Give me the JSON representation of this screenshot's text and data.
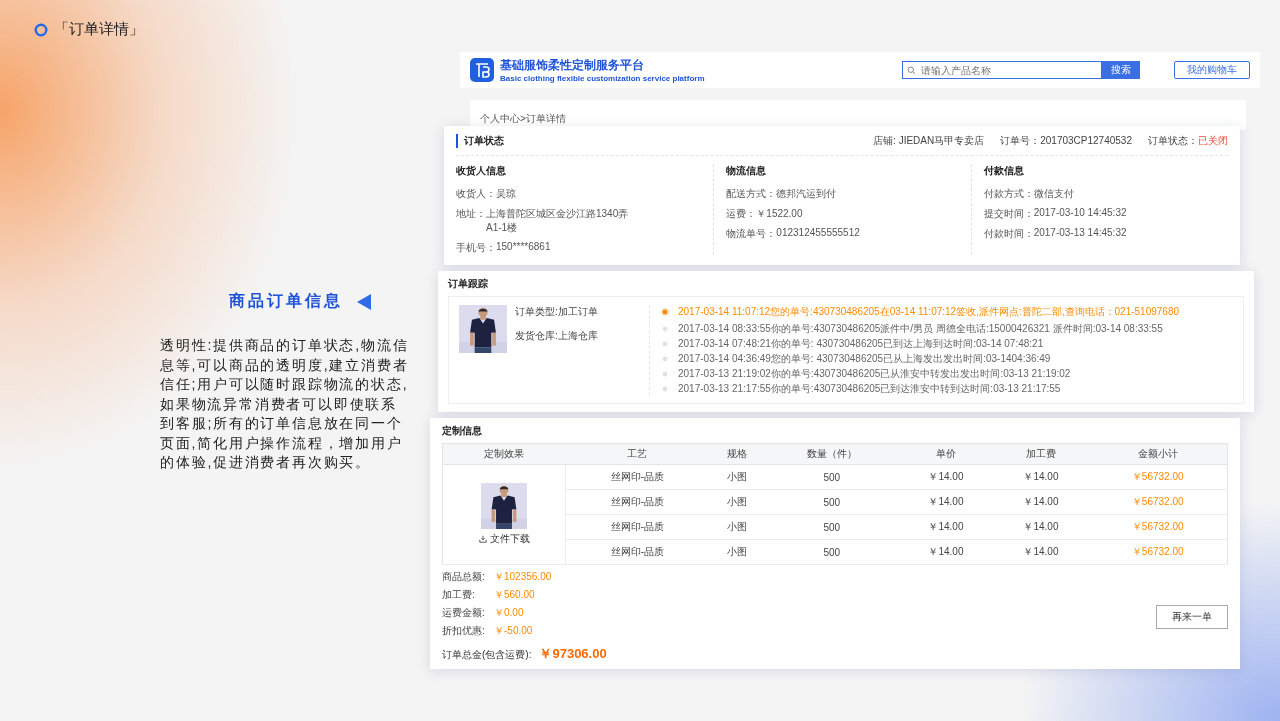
{
  "slide": {
    "title": "「订单详情」",
    "heading": "商品订单信息",
    "description": "透明性:提供商品的订单状态,物流信息等,可以商品的透明度,建立消费者信任;用户可以随时跟踪物流的状态,如果物流异常消费者可以即使联系到客服;所有的订单信息放在同一个页面,简化用户操作流程，增加用户的体验,促进消费者再次购买。"
  },
  "header": {
    "logo_title": "基础服饰柔性定制服务平台",
    "logo_subtitle": "Basic clothing flexible customization service platform",
    "search": {
      "placeholder": "请输入产品名称",
      "button": "搜索"
    },
    "cart_button": "我的购物车"
  },
  "breadcrumb": "个人中心>订单详情",
  "order_status": {
    "title": "订单状态",
    "shop": "店铺: JIEDAN马甲专卖店",
    "order_no": "订单号：201703CP12740532",
    "status_label": "订单状态：",
    "status": "已关闭",
    "sections": [
      {
        "title": "收货人信息",
        "lines": [
          {
            "label": "收货人：",
            "value": [
              "吴琼"
            ]
          },
          {
            "label": "地址：",
            "value": [
              "上海普陀区城区金沙江路1340弄",
              "A1-1楼"
            ]
          },
          {
            "label": "手机号：",
            "value": [
              "150****6861"
            ]
          }
        ]
      },
      {
        "title": "物流信息",
        "lines": [
          {
            "label": "配送方式：",
            "value": [
              "德邦汽运到付"
            ]
          },
          {
            "label": "运费：",
            "value": [
              "￥1522.00"
            ]
          },
          {
            "label": "物流单号：",
            "value": [
              "012312455555512"
            ]
          }
        ]
      },
      {
        "title": "付款信息",
        "lines": [
          {
            "label": "付款方式：",
            "value": [
              "微信支付"
            ]
          },
          {
            "label": "提交时间：",
            "value": [
              "2017-03-10 14:45:32"
            ]
          },
          {
            "label": "付款时间：",
            "value": [
              "2017-03-13 14:45:32"
            ]
          }
        ]
      }
    ]
  },
  "tracking": {
    "title": "订单跟踪",
    "order_type": "订单类型:加工订单",
    "warehouse": "发货仓库:上海仓库",
    "events": [
      {
        "text": "2017-03-14 11:07:12您的单号:430730486205在03-14 11:07:12签收,派件网点:普陀二部,查询电话：021-51097680",
        "current": true
      },
      {
        "text": "2017-03-14 08:33:55你的单号:430730486205派件中/男员 周德全电话:15000426321 派件时间:03-14 08:33:55",
        "current": false
      },
      {
        "text": "2017-03-14 07:48:21你的单号: 430730486205已到达上海到达时间:03-14 07:48:21",
        "current": false
      },
      {
        "text": "2017-03-14 04:36:49您的单号: 430730486205已从上海发出发出时间:03-1404:36:49",
        "current": false
      },
      {
        "text": "2017-03-13 21:19:02你的单号:430730486205已从淮安中转发出发出时间:03-13 21:19:02",
        "current": false
      },
      {
        "text": "2017-03-13 21:17:55你的单号:430730486205已到达淮安中转到达时间:03-13 21:17:55",
        "current": false
      }
    ]
  },
  "custom": {
    "title": "定制信息",
    "columns": [
      "定制效果",
      "工艺",
      "规格",
      "数量（件）",
      "单价",
      "加工费",
      "金额小计"
    ],
    "download": "文件下载",
    "rows": [
      {
        "craft": "丝网印-品质",
        "spec": "小图",
        "qty": "500",
        "price": "￥14.00",
        "fee": "￥14.00",
        "subtotal": "￥56732.00"
      },
      {
        "craft": "丝网印-品质",
        "spec": "小图",
        "qty": "500",
        "price": "￥14.00",
        "fee": "￥14.00",
        "subtotal": "￥56732.00"
      },
      {
        "craft": "丝网印-品质",
        "spec": "小图",
        "qty": "500",
        "price": "￥14.00",
        "fee": "￥14.00",
        "subtotal": "￥56732.00"
      },
      {
        "craft": "丝网印-品质",
        "spec": "小图",
        "qty": "500",
        "price": "￥14.00",
        "fee": "￥14.00",
        "subtotal": "￥56732.00"
      }
    ],
    "totals": [
      {
        "label": "商品总额:",
        "value": "￥102356.00"
      },
      {
        "label": "加工费:",
        "value": "￥560.00"
      },
      {
        "label": "运费金额:",
        "value": "￥0.00"
      },
      {
        "label": "折扣优惠:",
        "value": "￥-50.00"
      }
    ],
    "grand_total": {
      "label": "订单总金(包含运费):",
      "value": "￥97306.00"
    },
    "reorder_button": "再来一单"
  }
}
